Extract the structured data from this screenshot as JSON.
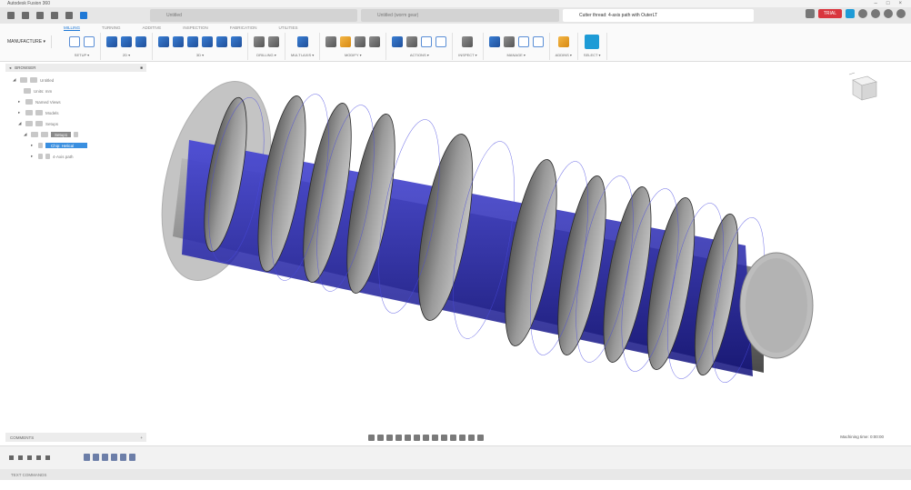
{
  "window": {
    "title": "Autodesk Fusion 360"
  },
  "tabs": [
    {
      "label": "Untitled"
    },
    {
      "label": "Untitled (worm gear)"
    },
    {
      "label": "Cutter thread: 4-axis path with OuterLT"
    }
  ],
  "header": {
    "trial_label": "TRIAL"
  },
  "ribbon": {
    "workspace": "MANUFACTURE ▾",
    "tabs": [
      "MILLING",
      "TURNING",
      "ADDITIVE",
      "INSPECTION",
      "FABRICATION",
      "UTILITIES"
    ],
    "groups": [
      "SETUP ▾",
      "2D ▾",
      "3D ▾",
      "DRILLING ▾",
      "MULTI-AXIS ▾",
      "MODIFY ▾",
      "ACTIONS ▾",
      "INSPECT ▾",
      "MANAGE ▾",
      "ADDINS ▾",
      "SELECT ▾"
    ]
  },
  "browser": {
    "title": "BROWSER",
    "nodes": [
      {
        "label": "Untitled"
      },
      {
        "label": "Units: mm"
      },
      {
        "label": "Named Views"
      },
      {
        "label": "Models"
      },
      {
        "label": "Setups"
      },
      {
        "label": "Setup1"
      },
      {
        "label": "Chip: Helical"
      },
      {
        "label": "4-Axis path"
      }
    ]
  },
  "bottom": {
    "comments_label": "COMMENTS",
    "machining_label": "Machining time: 0:00:00",
    "text_commands": "TEXT COMMANDS"
  },
  "colors": {
    "accent": "#1e78d6",
    "toolpath": "#2a2ad0",
    "part": "#8c8c8c"
  }
}
